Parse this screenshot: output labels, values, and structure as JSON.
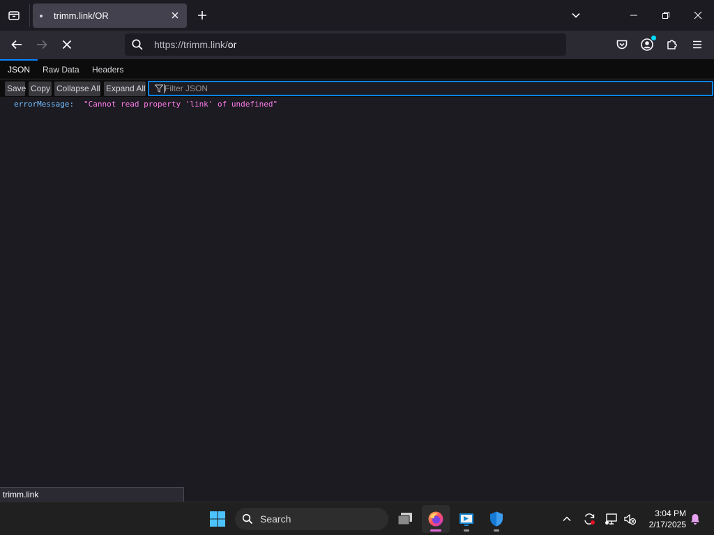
{
  "browser": {
    "tab": {
      "title": "trimm.link/OR"
    },
    "url": {
      "scheme_host": "https://trimm.link/",
      "path": "or"
    }
  },
  "json_viewer": {
    "tabs": [
      {
        "label": "JSON",
        "active": true
      },
      {
        "label": "Raw Data",
        "active": false
      },
      {
        "label": "Headers",
        "active": false
      }
    ],
    "toolbar": {
      "save": "Save",
      "copy": "Copy",
      "collapse_all": "Collapse All",
      "expand_all": "Expand All",
      "filter_placeholder": "Filter JSON"
    },
    "rows": [
      {
        "key": "errorMessage:",
        "value": "\"Cannot read property 'link' of undefined\""
      }
    ]
  },
  "status_bubble": "trimm.link",
  "taskbar": {
    "search_label": "Search",
    "time": "3:04 PM",
    "date": "2/17/2025"
  },
  "colors": {
    "accent": "#0a84ff",
    "json_key": "#75bfff",
    "json_string": "#ff7de9",
    "firefox_indicator": "#e36ddc"
  }
}
